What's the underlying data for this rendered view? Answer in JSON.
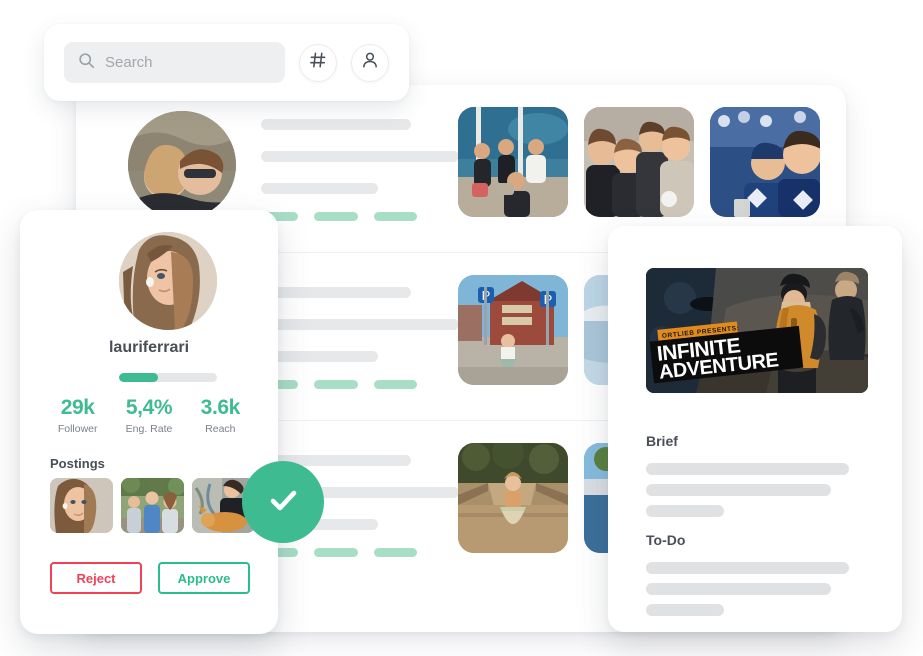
{
  "search": {
    "placeholder": "Search",
    "value": "",
    "hash_button_label": "#",
    "profile_button_label": "person"
  },
  "profile": {
    "username": "lauriferrari",
    "progress_percent": 40,
    "verified": true,
    "stats": [
      {
        "value": "29k",
        "label": "Follower"
      },
      {
        "value": "5,4%",
        "label": "Eng. Rate"
      },
      {
        "value": "3.6k",
        "label": "Reach"
      }
    ],
    "postings_title": "Postings",
    "postings": [
      {
        "alt": "selfie-portrait"
      },
      {
        "alt": "group-of-friends-outdoors"
      },
      {
        "alt": "woman-with-dog"
      }
    ],
    "reject_label": "Reject",
    "approve_label": "Approve"
  },
  "detail": {
    "hero": {
      "badge_text": "ORTLIEB PRESENTS:",
      "title_line_1": "INFINITE",
      "title_line_2": "ADVENTURE",
      "alt": "hikers-in-mountain-landscape"
    },
    "brief_title": "Brief",
    "todo_title": "To-Do"
  },
  "list": {
    "rows": [
      {
        "avatar_alt": "couple-with-sunglasses",
        "thumbs": [
          {
            "alt": "friends-at-beach-resort"
          },
          {
            "alt": "group-selfie-at-party"
          },
          {
            "alt": "two-men-at-stadium"
          }
        ]
      },
      {
        "avatar_alt": "hidden-avatar",
        "thumbs": [
          {
            "alt": "woman-by-red-cabin-street"
          },
          {
            "alt": "snowy-coastline"
          },
          {
            "alt": "third-photo"
          }
        ]
      },
      {
        "avatar_alt": "hidden-avatar",
        "thumbs": [
          {
            "alt": "woman-on-wooden-bridge"
          },
          {
            "alt": "person-sitting-outdoors"
          },
          {
            "alt": "third-photo"
          }
        ]
      }
    ]
  },
  "colors": {
    "accent_green": "#3fbb91",
    "tag_green": "#a8ddc6",
    "reject_red": "#ef4257",
    "approve_green": "#2bbd8a",
    "skeleton_gray": "#e6e8ea"
  }
}
